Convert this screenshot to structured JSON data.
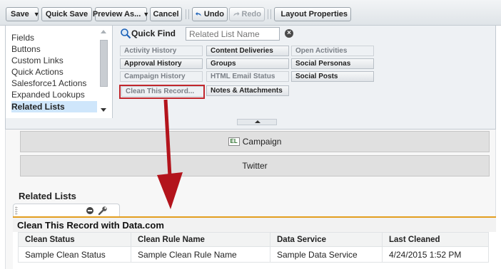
{
  "toolbar": {
    "save": "Save",
    "save_menu": "▼",
    "quick_save": "Quick Save",
    "preview_as": "Preview As...",
    "preview_menu": "▼",
    "cancel": "Cancel",
    "undo": "Undo",
    "redo": "Redo",
    "layout_properties": "Layout Properties"
  },
  "palette": {
    "categories": [
      {
        "label": "Fields",
        "selected": false
      },
      {
        "label": "Buttons",
        "selected": false
      },
      {
        "label": "Custom Links",
        "selected": false
      },
      {
        "label": "Quick Actions",
        "selected": false
      },
      {
        "label": "Salesforce1 Actions",
        "selected": false
      },
      {
        "label": "Expanded Lookups",
        "selected": false
      },
      {
        "label": "Related Lists",
        "selected": true
      }
    ],
    "quick_find_label": "Quick Find",
    "quick_find_placeholder": "Related List Name",
    "items": [
      {
        "label": "Activity History",
        "used": true
      },
      {
        "label": "Content Deliveries",
        "used": false
      },
      {
        "label": "Open Activities",
        "used": true
      },
      {
        "label": "Approval History",
        "used": false
      },
      {
        "label": "Groups",
        "used": false
      },
      {
        "label": "Social Personas",
        "used": false
      },
      {
        "label": "Campaign History",
        "used": true
      },
      {
        "label": "HTML Email Status",
        "used": true
      },
      {
        "label": "Social Posts",
        "used": false
      },
      {
        "label": "Clean This Record...",
        "used": true
      },
      {
        "label": "Notes & Attachments",
        "used": false
      }
    ]
  },
  "layout": {
    "campaign_icon": "EL",
    "campaign": "Campaign",
    "twitter": "Twitter",
    "related_lists_title": "Related Lists",
    "section_title": "Clean This Record with Data.com",
    "columns": [
      "Clean Status",
      "Clean Rule Name",
      "Data Service",
      "Last Cleaned"
    ],
    "row": [
      "Sample Clean Status",
      "Sample Clean Rule Name",
      "Sample Data Service",
      "4/24/2015 1:52 PM"
    ]
  },
  "colors": {
    "accent_orange": "#e39e1f",
    "highlight_red": "#c1272d",
    "selected_blue": "#cfe6fb"
  }
}
